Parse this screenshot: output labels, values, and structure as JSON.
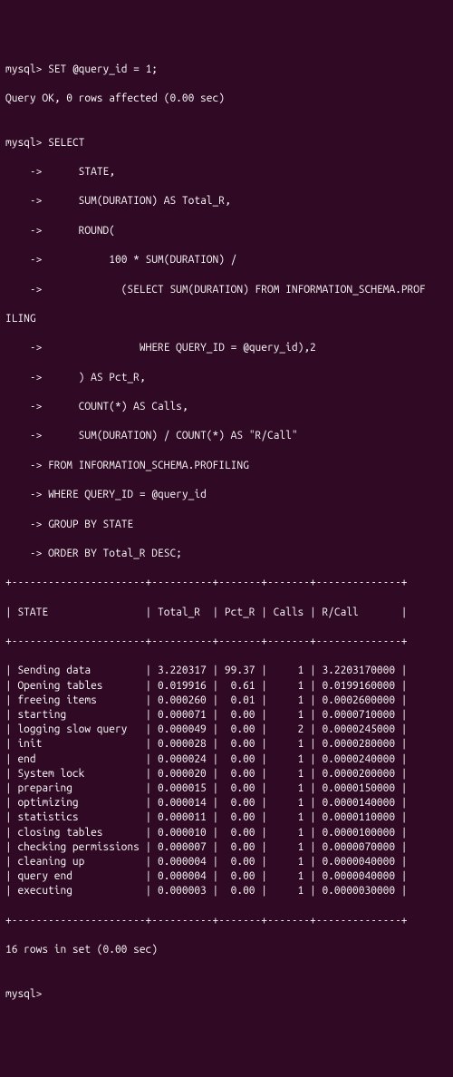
{
  "session": {
    "prompt": "mysql>",
    "cont": "    ->",
    "line_set": "SET @query_id = 1;",
    "line_set_result": "Query OK, 0 rows affected (0.00 sec)",
    "blank": "",
    "select_lines": [
      "SELECT",
      "     STATE,",
      "     SUM(DURATION) AS Total_R,",
      "     ROUND(",
      "          100 * SUM(DURATION) /",
      "            (SELECT SUM(DURATION) FROM INFORMATION_SCHEMA.PROF"
    ],
    "wrap_iling": "ILING",
    "select_lines2": [
      "               WHERE QUERY_ID = @query_id),2",
      "     ) AS Pct_R,",
      "     COUNT(*) AS Calls,",
      "     SUM(DURATION) / COUNT(*) AS \"R/Call\"",
      "FROM INFORMATION_SCHEMA.PROFILING",
      "WHERE QUERY_ID = @query_id",
      "GROUP BY STATE",
      "ORDER BY Total_R DESC;"
    ],
    "table": {
      "border": "+----------------------+----------+-------+-------+--------------+",
      "header": "| STATE                | Total_R  | Pct_R | Calls | R/Call       |",
      "rows": [
        {
          "state": "Sending data",
          "total_r": "3.220317",
          "pct_r": "99.37",
          "calls": "1",
          "rcall": "3.2203170000"
        },
        {
          "state": "Opening tables",
          "total_r": "0.019916",
          "pct_r": "0.61",
          "calls": "1",
          "rcall": "0.0199160000"
        },
        {
          "state": "freeing items",
          "total_r": "0.000260",
          "pct_r": "0.01",
          "calls": "1",
          "rcall": "0.0002600000"
        },
        {
          "state": "starting",
          "total_r": "0.000071",
          "pct_r": "0.00",
          "calls": "1",
          "rcall": "0.0000710000"
        },
        {
          "state": "logging slow query",
          "total_r": "0.000049",
          "pct_r": "0.00",
          "calls": "2",
          "rcall": "0.0000245000"
        },
        {
          "state": "init",
          "total_r": "0.000028",
          "pct_r": "0.00",
          "calls": "1",
          "rcall": "0.0000280000"
        },
        {
          "state": "end",
          "total_r": "0.000024",
          "pct_r": "0.00",
          "calls": "1",
          "rcall": "0.0000240000"
        },
        {
          "state": "System lock",
          "total_r": "0.000020",
          "pct_r": "0.00",
          "calls": "1",
          "rcall": "0.0000200000"
        },
        {
          "state": "preparing",
          "total_r": "0.000015",
          "pct_r": "0.00",
          "calls": "1",
          "rcall": "0.0000150000"
        },
        {
          "state": "optimizing",
          "total_r": "0.000014",
          "pct_r": "0.00",
          "calls": "1",
          "rcall": "0.0000140000"
        },
        {
          "state": "statistics",
          "total_r": "0.000011",
          "pct_r": "0.00",
          "calls": "1",
          "rcall": "0.0000110000"
        },
        {
          "state": "closing tables",
          "total_r": "0.000010",
          "pct_r": "0.00",
          "calls": "1",
          "rcall": "0.0000100000"
        },
        {
          "state": "checking permissions",
          "total_r": "0.000007",
          "pct_r": "0.00",
          "calls": "1",
          "rcall": "0.0000070000"
        },
        {
          "state": "cleaning up",
          "total_r": "0.000004",
          "pct_r": "0.00",
          "calls": "1",
          "rcall": "0.0000040000"
        },
        {
          "state": "query end",
          "total_r": "0.000004",
          "pct_r": "0.00",
          "calls": "1",
          "rcall": "0.0000040000"
        },
        {
          "state": "executing",
          "total_r": "0.000003",
          "pct_r": "0.00",
          "calls": "1",
          "rcall": "0.0000030000"
        }
      ]
    },
    "footer": "16 rows in set (0.00 sec)"
  }
}
